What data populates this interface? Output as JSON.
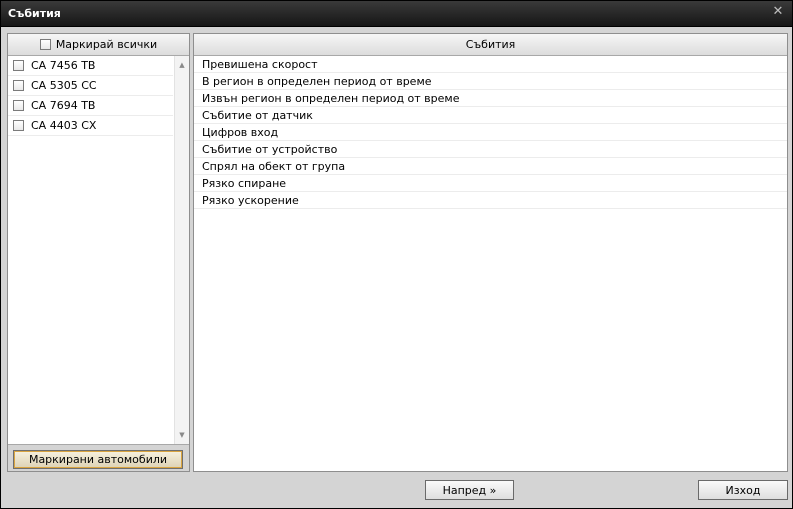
{
  "window": {
    "title": "Събития",
    "close_glyph": "✕"
  },
  "vehicles": {
    "select_all_label": "Маркирай всички",
    "items": [
      {
        "label": "CA 7456 TB",
        "checked": false
      },
      {
        "label": "CA 5305 CC",
        "checked": false
      },
      {
        "label": "CA 7694 TB",
        "checked": false
      },
      {
        "label": "CA 4403 CX",
        "checked": false
      }
    ],
    "marked_button_label": "Маркирани автомобили"
  },
  "events": {
    "header": "Събития",
    "items": [
      "Превишена скорост",
      "В регион в определен период от време",
      "Извън регион в определен период от време",
      "Събитие от датчик",
      "Цифров вход",
      "Събитие от устройство",
      "Спрял на обект от група",
      "Рязко спиране",
      "Рязко ускорение"
    ]
  },
  "footer": {
    "next_label": "Напред »",
    "exit_label": "Изход"
  },
  "icons": {
    "scroll_up": "▲",
    "scroll_down": "▼"
  }
}
